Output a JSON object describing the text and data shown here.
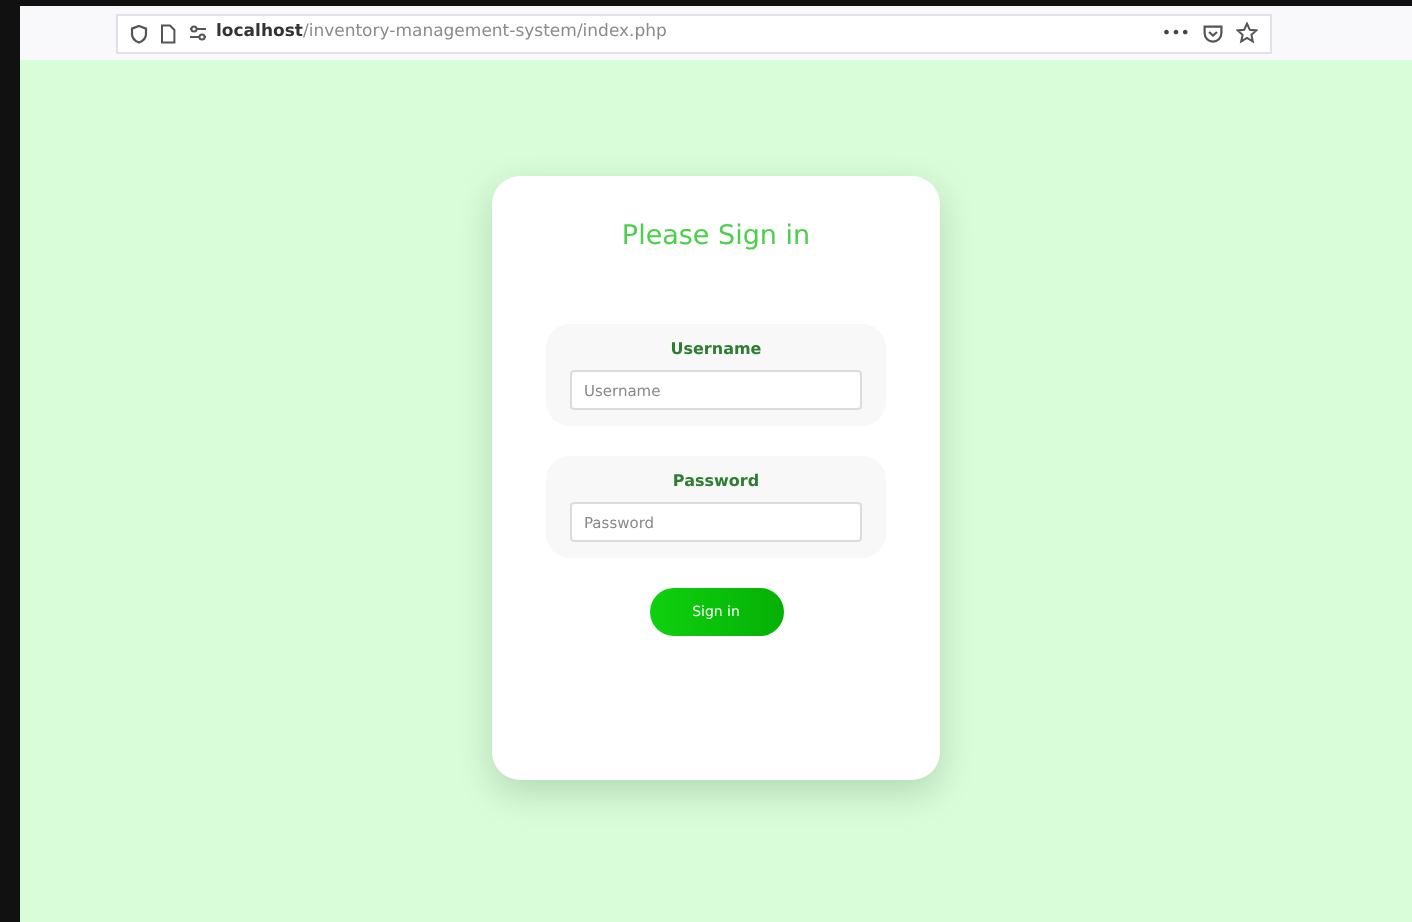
{
  "browser": {
    "url": "**localhost**/inventory-management-system/index.php",
    "menu_glyph": "•••"
  },
  "login": {
    "title": "Please Sign in",
    "fields": [
      {
        "label": "Username",
        "placeholder": "Username"
      },
      {
        "label": "Password",
        "placeholder": "Password"
      }
    ],
    "button": "Sign in"
  }
}
